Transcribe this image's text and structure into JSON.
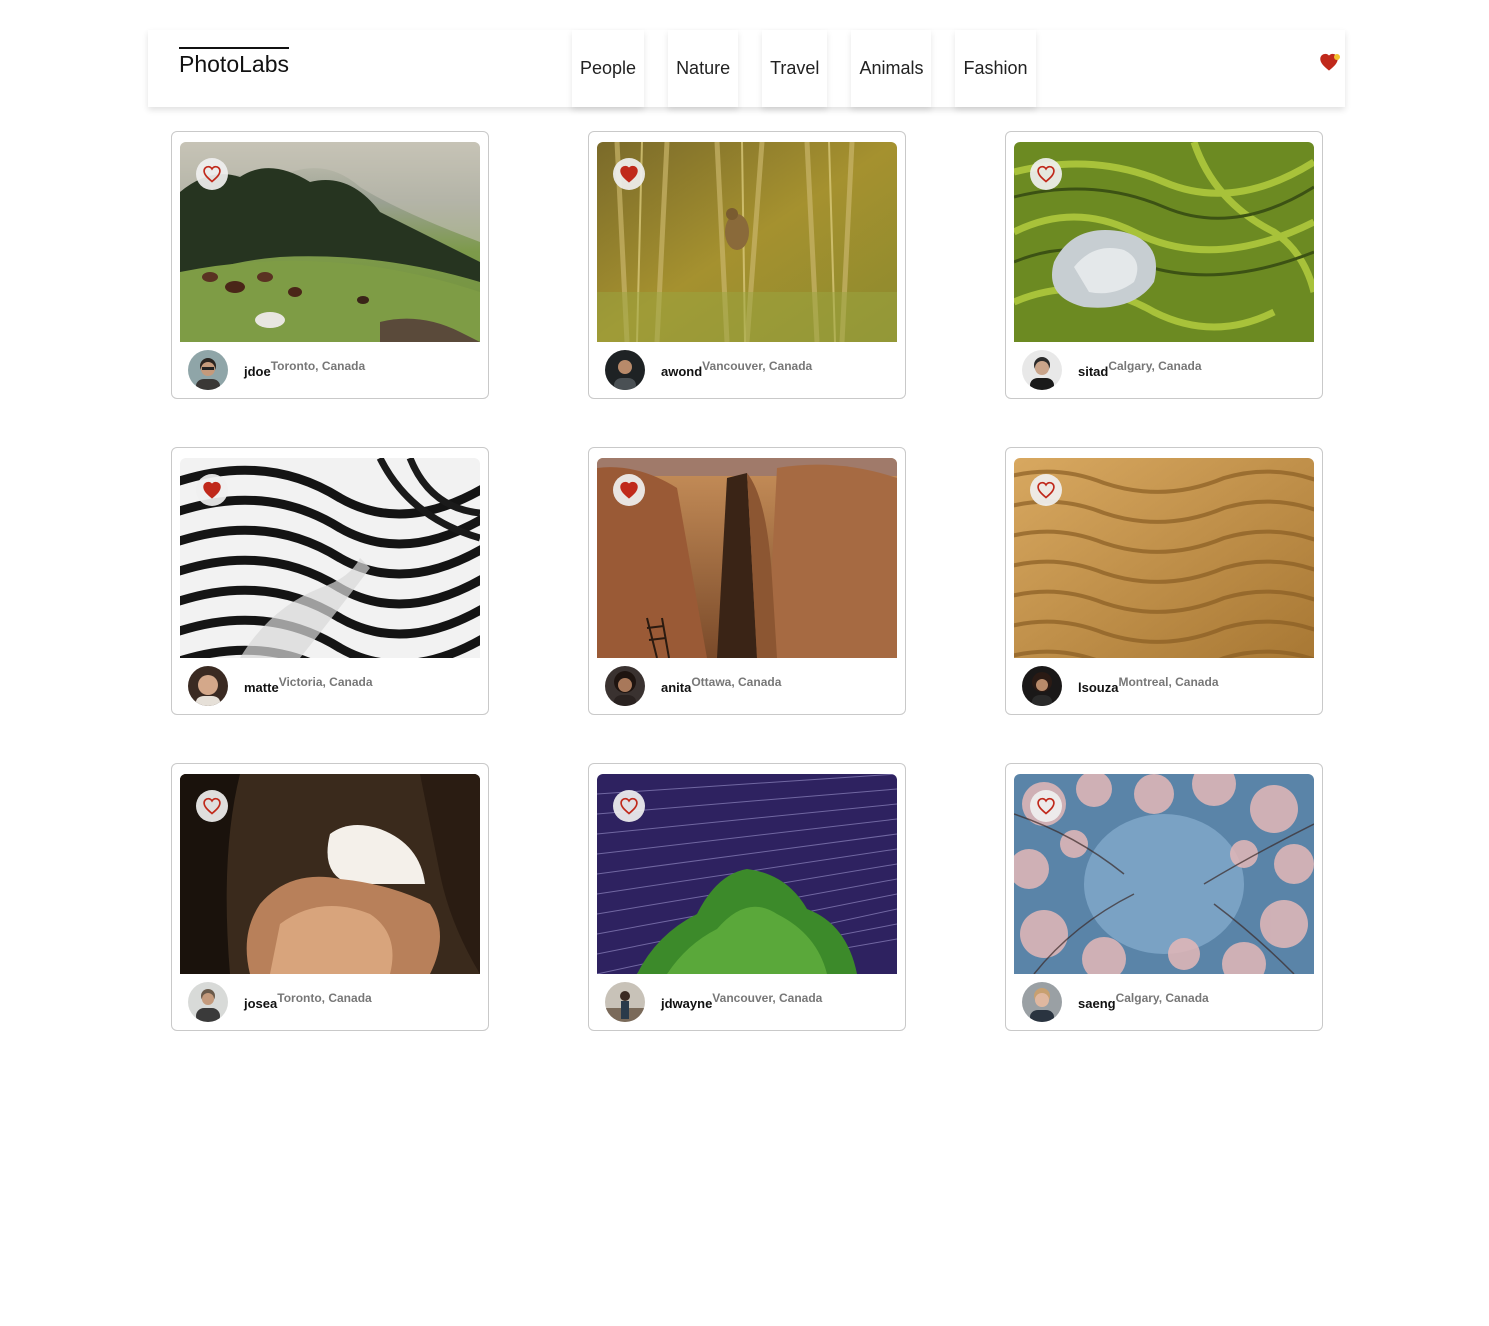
{
  "nav": {
    "logo": "PhotoLabs",
    "topics": [
      "People",
      "Nature",
      "Travel",
      "Animals",
      "Fashion"
    ],
    "fav_icon": "heart-icon",
    "fav_has_notification": true
  },
  "colors": {
    "accent": "#c0291b",
    "notify": "#f2c12e"
  },
  "photos": [
    {
      "username": "jdoe",
      "location": "Toronto, Canada",
      "favourited": false
    },
    {
      "username": "awond",
      "location": "Vancouver, Canada",
      "favourited": true
    },
    {
      "username": "sitad",
      "location": "Calgary, Canada",
      "favourited": false
    },
    {
      "username": "matte",
      "location": "Victoria, Canada",
      "favourited": true
    },
    {
      "username": "anita",
      "location": "Ottawa, Canada",
      "favourited": true
    },
    {
      "username": "lsouza",
      "location": "Montreal, Canada",
      "favourited": false
    },
    {
      "username": "josea",
      "location": "Toronto, Canada",
      "favourited": false
    },
    {
      "username": "jdwayne",
      "location": "Vancouver, Canada",
      "favourited": false
    },
    {
      "username": "saeng",
      "location": "Calgary, Canada",
      "favourited": false
    }
  ]
}
